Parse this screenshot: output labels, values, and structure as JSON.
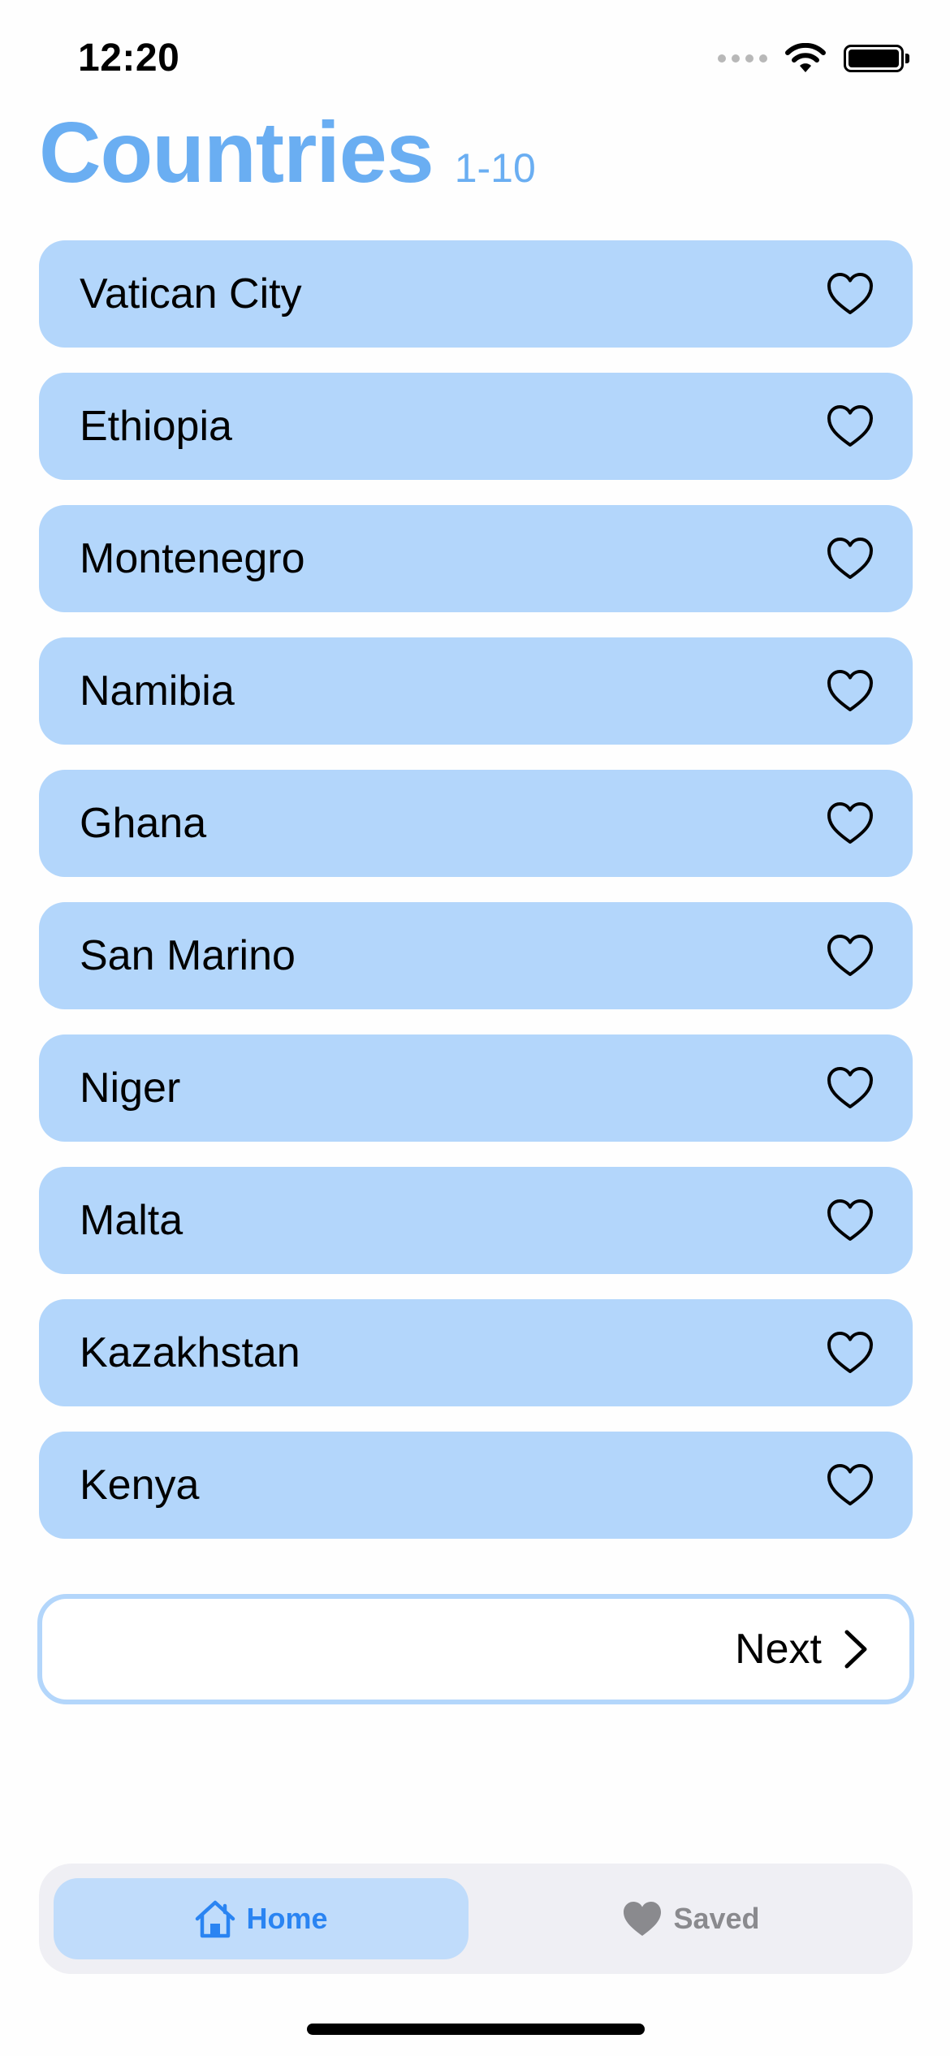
{
  "status_bar": {
    "time": "12:20"
  },
  "header": {
    "title": "Countries",
    "range": "1-10"
  },
  "countries": [
    {
      "name": "Vatican City",
      "icon": "heart-outline-icon"
    },
    {
      "name": "Ethiopia",
      "icon": "heart-outline-icon"
    },
    {
      "name": "Montenegro",
      "icon": "heart-outline-icon"
    },
    {
      "name": "Namibia",
      "icon": "heart-outline-icon"
    },
    {
      "name": "Ghana",
      "icon": "heart-outline-icon"
    },
    {
      "name": "San Marino",
      "icon": "heart-outline-icon"
    },
    {
      "name": "Niger",
      "icon": "heart-outline-icon"
    },
    {
      "name": "Malta",
      "icon": "heart-outline-icon"
    },
    {
      "name": "Kazakhstan",
      "icon": "heart-outline-icon"
    },
    {
      "name": "Kenya",
      "icon": "heart-outline-icon"
    }
  ],
  "pagination": {
    "next_label": "Next",
    "icon": "chevron-right-icon"
  },
  "tab_bar": {
    "tabs": [
      {
        "label": "Home",
        "icon": "house-icon",
        "active": true
      },
      {
        "label": "Saved",
        "icon": "heart-filled-icon",
        "active": false
      }
    ]
  },
  "colors": {
    "accent": "#6aaef2",
    "list_item_bg": "#b3d6fb",
    "active_tab_bg": "#c0dcfb",
    "active_tab_text": "#2a84f2",
    "inactive_tab_text": "#8a8a8e",
    "tab_bar_bg": "#efeff4"
  }
}
